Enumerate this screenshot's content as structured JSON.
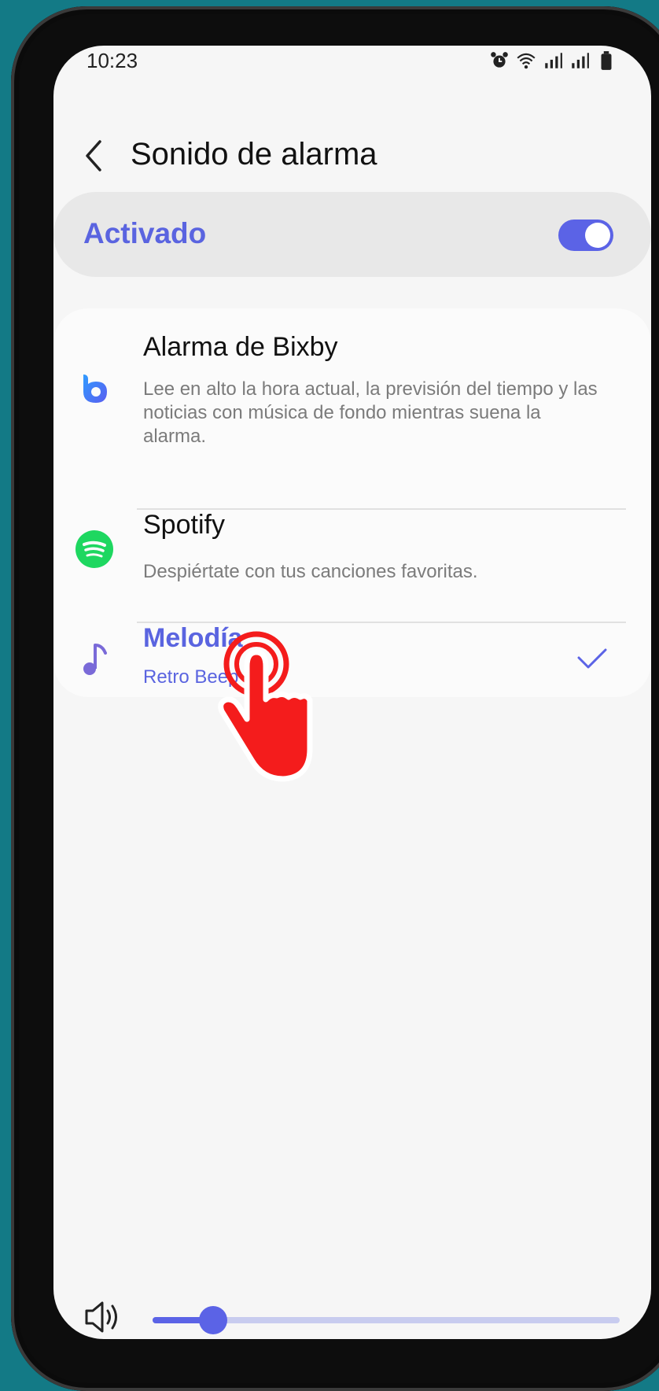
{
  "status_bar": {
    "time": "10:23",
    "icons": [
      "alarm-icon",
      "wifi-icon",
      "signal-icon",
      "signal-icon",
      "battery-icon"
    ]
  },
  "header": {
    "title": "Sonido de alarma",
    "back_icon": "chevron-left-icon"
  },
  "activated": {
    "label": "Activado",
    "toggle_on": true
  },
  "options": [
    {
      "title": "Alarma de Bixby",
      "description": "Lee en alto la hora actual, la previsión del tiempo y las noticias con música de fondo mientras suena la alarma.",
      "icon": "bixby-icon",
      "selected": false
    },
    {
      "title": "Spotify",
      "description": "Despiértate con tus canciones favoritas.",
      "icon": "spotify-icon",
      "selected": false
    },
    {
      "title": "Melodía",
      "description": "Retro Beep",
      "icon": "music-note-icon",
      "selected": true
    }
  ],
  "volume": {
    "icon": "speaker-icon",
    "level": 0.13
  },
  "colors": {
    "accent": "#5b63e6",
    "accent_text": "#5a64e0",
    "background": "#f6f6f6",
    "spotify": "#1ed760",
    "tap_hand": "#f41c1c",
    "outer_background": "#137a86"
  }
}
